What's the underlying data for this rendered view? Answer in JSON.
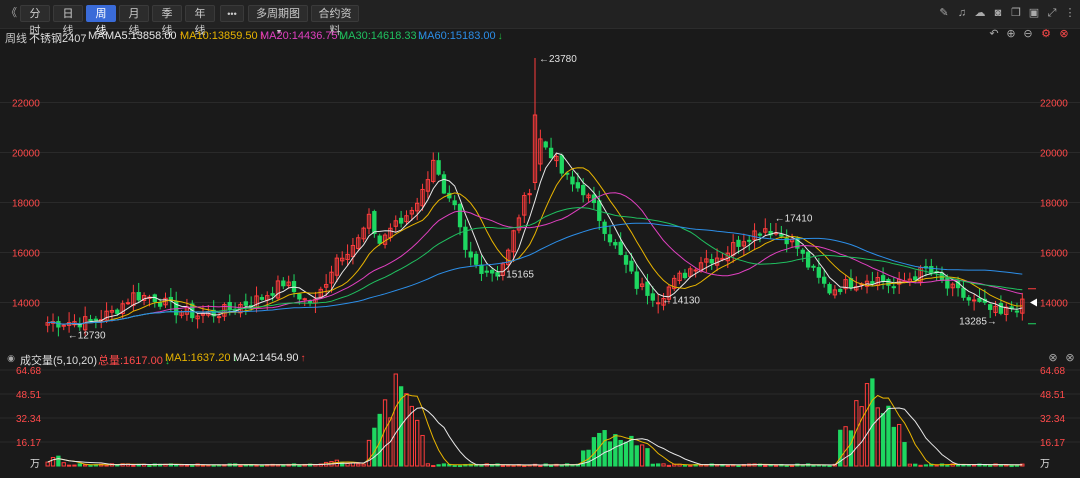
{
  "toolbar": {
    "collapse_glyph": "《",
    "periods": [
      "分时",
      "日线",
      "周线",
      "月线",
      "季线",
      "年线"
    ],
    "active_period": "周线",
    "more_label": "•••",
    "multi_period_label": "多周期图",
    "contract_label": "合约资料",
    "icons": [
      "draw-icon",
      "alert-icon",
      "cloud-icon",
      "camera-icon",
      "copy-icon",
      "window-icon",
      "fullscreen-icon",
      "more-vertical-icon"
    ]
  },
  "legend": {
    "period": "周线",
    "contract": "不锈钢2407",
    "ma_label": "MA",
    "items": [
      {
        "text": "MA5:13858.00",
        "arrow": "↑",
        "color": "#e8e8e8",
        "arrow_color": "#ff4040"
      },
      {
        "text": "MA10:13859.50",
        "arrow": "↑",
        "color": "#e8b400",
        "arrow_color": "#ff4040"
      },
      {
        "text": "MA20:14436.75",
        "arrow": "↓",
        "color": "#e040c0",
        "arrow_color": "#20c040"
      },
      {
        "text": "MA30:14618.33",
        "arrow": "↓",
        "color": "#20c060",
        "arrow_color": "#20c040"
      },
      {
        "text": "MA60:15183.00",
        "arrow": "↓",
        "color": "#2c8ee8",
        "arrow_color": "#20c040"
      }
    ]
  },
  "colors": {
    "up": "#ff3c3c",
    "down": "#1ed761",
    "bg": "#1a1a1a",
    "grid": "#2a2a2a",
    "axis_text": "#ff4a4a"
  },
  "chart_data": [
    {
      "type": "candlestick",
      "title": "周线 不锈钢2407",
      "y_ticks": [
        14000,
        16000,
        18000,
        20000,
        22000
      ],
      "ylim": [
        12300,
        24300
      ],
      "annotations": [
        {
          "label": "12730",
          "index": 3,
          "value": 12730,
          "side": "right"
        },
        {
          "label": "23780",
          "index": 91,
          "value": 23780,
          "side": "right"
        },
        {
          "label": "15165",
          "index": 83,
          "value": 15165,
          "side": "right"
        },
        {
          "label": "14130",
          "index": 114,
          "value": 14130,
          "side": "right"
        },
        {
          "label": "17410",
          "index": 135,
          "value": 17410,
          "side": "right"
        },
        {
          "label": "13285",
          "index": 178,
          "value": 13285,
          "side": "left"
        }
      ],
      "current_price_marker": 14000,
      "anchor_points": [
        [
          0,
          13200
        ],
        [
          8,
          13250
        ],
        [
          12,
          13600
        ],
        [
          16,
          14300
        ],
        [
          20,
          14200
        ],
        [
          24,
          13700
        ],
        [
          28,
          13500
        ],
        [
          32,
          13600
        ],
        [
          36,
          13900
        ],
        [
          40,
          14200
        ],
        [
          44,
          14800
        ],
        [
          48,
          14100
        ],
        [
          50,
          14000
        ],
        [
          54,
          15800
        ],
        [
          58,
          16500
        ],
        [
          60,
          17300
        ],
        [
          62,
          16400
        ],
        [
          64,
          17000
        ],
        [
          66,
          17200
        ],
        [
          68,
          17800
        ],
        [
          70,
          18400
        ],
        [
          72,
          19800
        ],
        [
          74,
          18200
        ],
        [
          76,
          17700
        ],
        [
          78,
          16000
        ],
        [
          80,
          15500
        ],
        [
          82,
          15300
        ],
        [
          84,
          15200
        ],
        [
          86,
          16000
        ],
        [
          88,
          17500
        ],
        [
          90,
          18600
        ],
        [
          92,
          20500
        ],
        [
          94,
          20000
        ],
        [
          96,
          19200
        ],
        [
          98,
          18700
        ],
        [
          100,
          18500
        ],
        [
          102,
          17800
        ],
        [
          104,
          17000
        ],
        [
          106,
          16200
        ],
        [
          110,
          14700
        ],
        [
          114,
          14200
        ],
        [
          118,
          15000
        ],
        [
          122,
          15700
        ],
        [
          126,
          15900
        ],
        [
          130,
          16600
        ],
        [
          134,
          17000
        ],
        [
          136,
          16800
        ],
        [
          138,
          16600
        ],
        [
          140,
          16200
        ],
        [
          142,
          15500
        ],
        [
          144,
          14900
        ],
        [
          146,
          14500
        ],
        [
          150,
          14800
        ],
        [
          154,
          15000
        ],
        [
          156,
          14900
        ],
        [
          158,
          14600
        ],
        [
          162,
          15100
        ],
        [
          164,
          15300
        ],
        [
          166,
          15000
        ],
        [
          168,
          14600
        ],
        [
          170,
          14400
        ],
        [
          172,
          14100
        ],
        [
          174,
          13900
        ],
        [
          176,
          13700
        ],
        [
          178,
          13500
        ],
        [
          180,
          13800
        ],
        [
          182,
          13900
        ]
      ],
      "count": 183,
      "spike": {
        "index": 91,
        "high": 23780,
        "open": 18800,
        "close": 21500,
        "low": 18500
      }
    },
    {
      "type": "bar",
      "title": "成交量(5,10,20)",
      "y_ticks": [
        16.17,
        32.34,
        48.51,
        64.68
      ],
      "y_tick_labels": [
        "16.17",
        "32.34",
        "48.51",
        "64.68"
      ],
      "unit_label": "万",
      "ylim": [
        0,
        66
      ],
      "clusters": [
        {
          "from": 0,
          "to": 3,
          "peak": 10
        },
        {
          "from": 50,
          "to": 58,
          "peak": 4
        },
        {
          "from": 60,
          "to": 70,
          "peak": 66
        },
        {
          "from": 100,
          "to": 112,
          "peak": 32
        },
        {
          "from": 148,
          "to": 160,
          "peak": 66
        }
      ]
    }
  ],
  "volume_legend": {
    "title": "成交量(5,10,20)",
    "items": [
      {
        "text": "总量:1617.00",
        "arrow": "↓",
        "color": "#ff4a4a",
        "arrow_color": "#20c040"
      },
      {
        "text": "MA1:1637.20",
        "arrow": "↓",
        "color": "#e8b400",
        "arrow_color": "#20c040"
      },
      {
        "text": "MA2:1454.90",
        "arrow": "↑",
        "color": "#e8e8e8",
        "arrow_color": "#ff4040"
      }
    ]
  }
}
